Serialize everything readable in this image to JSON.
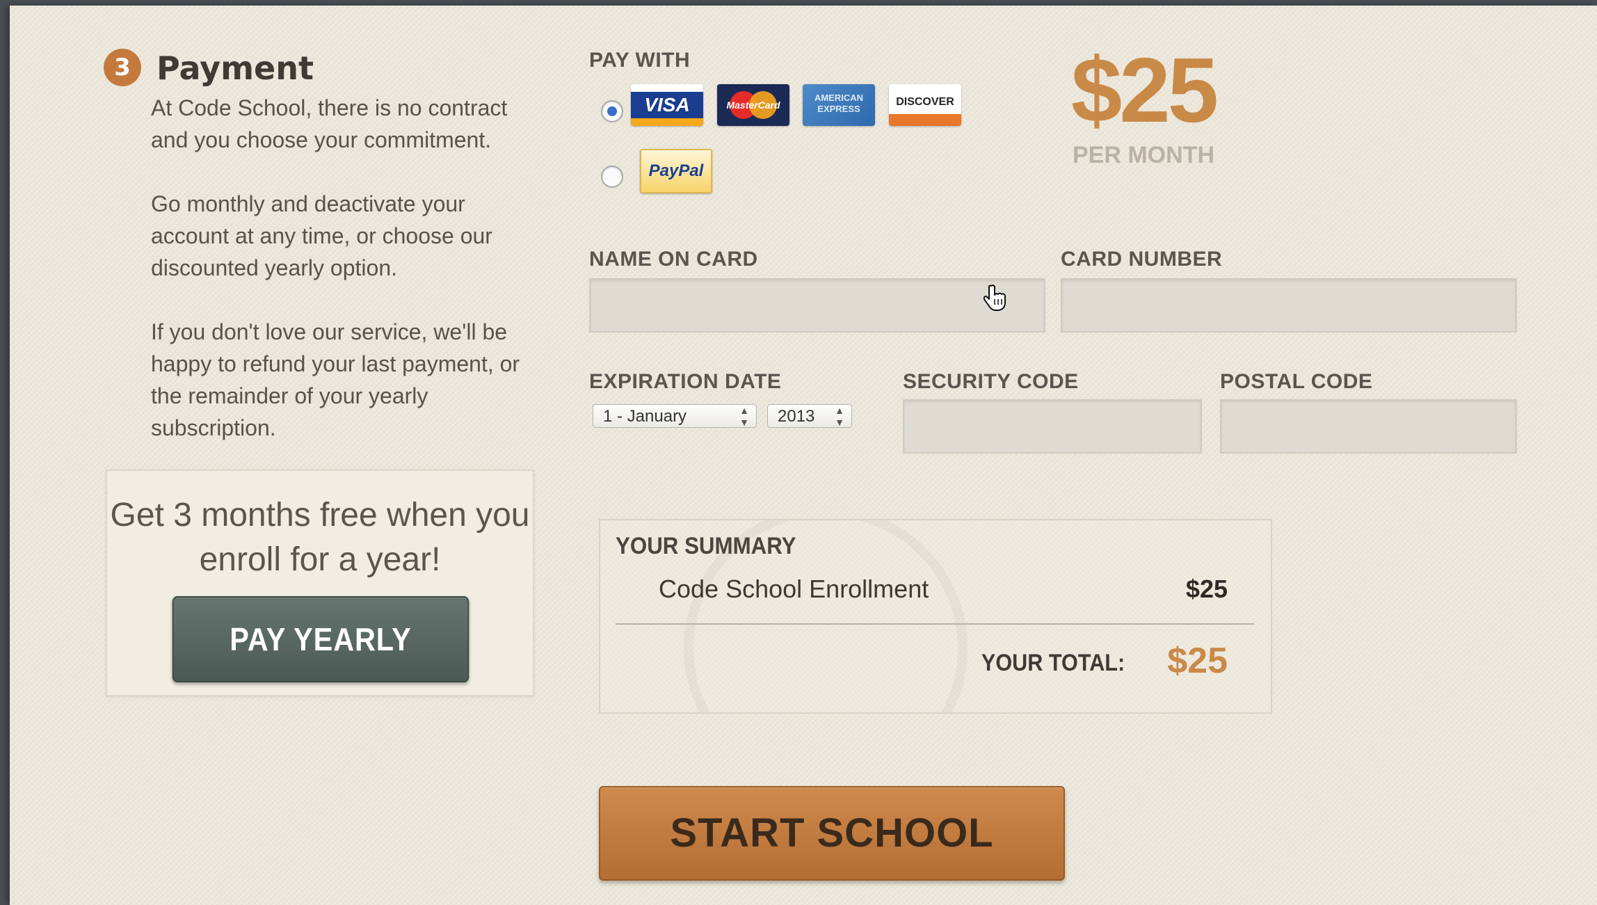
{
  "step": {
    "number": "3",
    "title": "Payment"
  },
  "intro": {
    "paragraphs": [
      "At Code School, there is no contract and you choose your commitment.",
      "Go monthly and deactivate your account at any time, or choose our discounted yearly option.",
      "If you don't love our service, we'll be happy to refund your last payment, or the remainder of your yearly subscription."
    ]
  },
  "promo": {
    "text": "Get 3 months free when you enroll for a year!",
    "button_label": "PAY YEARLY"
  },
  "pay_with": {
    "label": "PAY WITH",
    "selected_method": "card",
    "cards": [
      "VISA",
      "MasterCard",
      "AMERICAN EXPRESS",
      "DISCOVER"
    ],
    "paypal": "PayPal"
  },
  "price": {
    "amount": "$25",
    "period": "PER MONTH"
  },
  "form": {
    "name_on_card_label": "NAME ON CARD",
    "name_on_card_value": "",
    "card_number_label": "CARD NUMBER",
    "card_number_value": "",
    "expiration_label": "EXPIRATION DATE",
    "expiration_month": "1 - January",
    "expiration_year": "2013",
    "security_code_label": "SECURITY CODE",
    "security_code_value": "",
    "postal_code_label": "POSTAL CODE",
    "postal_code_value": ""
  },
  "summary": {
    "title": "YOUR SUMMARY",
    "item_name": "Code School Enrollment",
    "item_price": "$25",
    "total_label": "YOUR TOTAL:",
    "total_value": "$25"
  },
  "submit": {
    "label": "START SCHOOL"
  },
  "colors": {
    "accent": "#c98a48",
    "button_dark": "#55635e",
    "background": "#ebe6d9"
  }
}
